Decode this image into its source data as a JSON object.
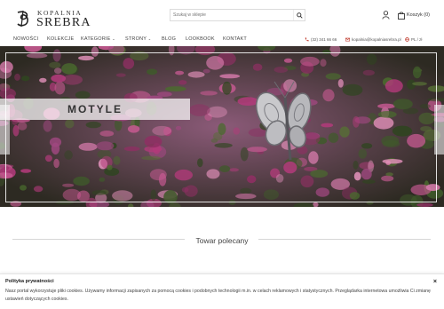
{
  "brand": {
    "line1": "KOPALNIA",
    "line2": "SREBRA"
  },
  "search": {
    "placeholder": "Szukaj w sklepie"
  },
  "cart": {
    "label": "Koszyk (0)"
  },
  "nav": {
    "items": [
      "NOWOŚCI",
      "KOLEKCJE",
      "KATEGORIE",
      "STRONY",
      "BLOG",
      "LOOKBOOK",
      "KONTAKT"
    ],
    "phone": "(32) 341 66 66",
    "email": "kopalnia@kopalniasrebra.pl",
    "locale": "PL / zł"
  },
  "hero": {
    "label": "MOTYLE"
  },
  "section": {
    "title": "Towar polecany"
  },
  "cookie": {
    "title": "Polityka prywatności",
    "text": "Nasz portal wykorzystuje pliki cookies. Używamy informacji zapisanych za pomocą cookies i podobnych technologii m.in. w celach reklamowych i statystycznych. Przeglądarka internetowa umożliwia Ci zmianę ustawień dotyczących cookies.",
    "close": "×"
  },
  "colors": {
    "accent": "#c0392b",
    "heather": "#a3356e",
    "foliage": "#3f5a2a"
  }
}
